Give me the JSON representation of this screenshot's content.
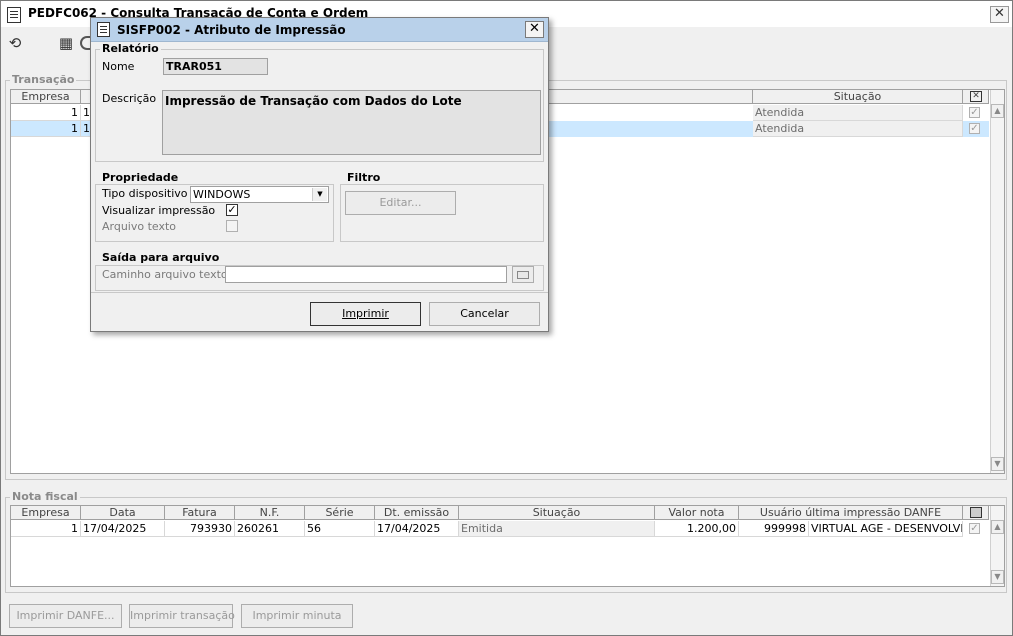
{
  "main_window": {
    "title": "PEDFC062 - Consulta Transação de Conta e Ordem",
    "close_glyph": "✕"
  },
  "toolbar": {
    "icons": [
      "refresh-icon",
      "calendar-icon",
      "clock-icon"
    ],
    "refresh_glyph": "⟲",
    "calendar_glyph": "▦"
  },
  "transacao": {
    "group_label": "Transação",
    "columns": {
      "empresa": "Empresa",
      "situacao": "Situação"
    },
    "rows": [
      {
        "empresa": "1",
        "col2": "1",
        "situacao": "Atendida",
        "checked": true,
        "selected": false
      },
      {
        "empresa": "1",
        "col2": "1",
        "situacao": "Atendida",
        "checked": true,
        "selected": true
      }
    ]
  },
  "nota_fiscal": {
    "group_label": "Nota fiscal",
    "columns": {
      "empresa": "Empresa",
      "data": "Data",
      "fatura": "Fatura",
      "nf": "N.F.",
      "serie": "Série",
      "dt_emissao": "Dt. emissão",
      "situacao": "Situação",
      "valor": "Valor nota",
      "usuario": "Usuário última impressão DANFE"
    },
    "rows": [
      {
        "empresa": "1",
        "data": "17/04/2025",
        "fatura": "793930",
        "nf": "260261",
        "serie": "56",
        "dt_emissao": "17/04/2025",
        "situacao": "Emitida",
        "valor": "1.200,00",
        "usuario_id": "999998",
        "usuario_nome": "VIRTUAL AGE - DESENVOLVIM",
        "checked": true
      }
    ]
  },
  "bottom_buttons": {
    "imprimir_danfe": "Imprimir DANFE...",
    "imprimir_transacao": "Imprimir transação",
    "imprimir_minuta": "Imprimir minuta"
  },
  "scroll": {
    "up": "▲",
    "down": "▼"
  },
  "checkmark": "✓",
  "dialog": {
    "title": "SISFP002 - Atributo de Impressão",
    "close_glyph": "✕",
    "relatorio": {
      "label": "Relatório",
      "nome_label": "Nome",
      "nome_value": "TRAR051",
      "descricao_label": "Descrição",
      "descricao_value": "Impressão de Transação com Dados do Lote"
    },
    "propriedade": {
      "label": "Propriedade",
      "tipo_label": "Tipo dispositivo",
      "tipo_value": "WINDOWS",
      "visualizar_label": "Visualizar impressão",
      "visualizar_checked": true,
      "arquivo_label": "Arquivo texto",
      "arquivo_checked": false
    },
    "filtro": {
      "label": "Filtro",
      "editar_label": "Editar..."
    },
    "saida": {
      "label": "Saída para arquivo",
      "caminho_label": "Caminho arquivo texto",
      "caminho_value": ""
    },
    "imprimir_label": "Imprimir",
    "cancelar_label": "Cancelar"
  },
  "colors": {
    "dialog_title_bg": "#b9d1ea",
    "selected_row_bg": "#cce8ff",
    "window_bg": "#f0f0f0"
  }
}
